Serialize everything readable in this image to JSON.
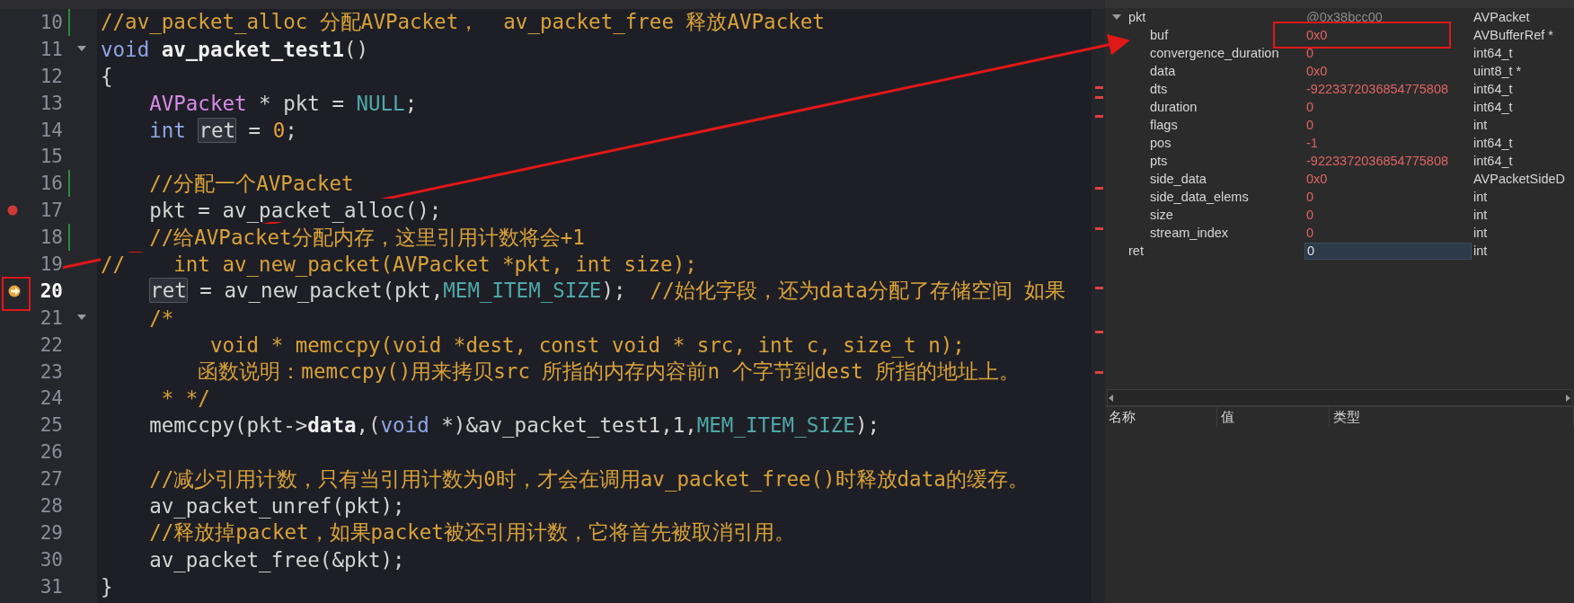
{
  "editor": {
    "lines": [
      {
        "number": "10",
        "fold": false,
        "breakpoint": false,
        "current": false,
        "changed": true,
        "tokens": [
          {
            "kind": "comment",
            "t": "//av_packet_alloc 分配AVPacket，  av_packet_free 释放AVPacket"
          }
        ]
      },
      {
        "number": "11",
        "fold": true,
        "breakpoint": false,
        "current": false,
        "changed": false,
        "tokens": [
          {
            "kind": "keyword",
            "t": "void "
          },
          {
            "kind": "bold",
            "t": "av_packet_test1"
          },
          {
            "kind": "plain",
            "t": "()"
          }
        ]
      },
      {
        "number": "12",
        "fold": false,
        "breakpoint": false,
        "current": false,
        "changed": false,
        "tokens": [
          {
            "kind": "plain",
            "t": "{"
          }
        ]
      },
      {
        "number": "13",
        "fold": false,
        "breakpoint": false,
        "current": false,
        "changed": false,
        "tokens": [
          {
            "kind": "type",
            "t": "    AVPacket"
          },
          {
            "kind": "plain",
            "t": " * pkt = "
          },
          {
            "kind": "macro",
            "t": "NULL"
          },
          {
            "kind": "plain",
            "t": ";"
          }
        ]
      },
      {
        "number": "14",
        "fold": false,
        "breakpoint": false,
        "current": false,
        "changed": false,
        "tokens": [
          {
            "kind": "keyword",
            "t": "    int"
          },
          {
            "kind": "mark",
            "t": " ret"
          },
          {
            "kind": "plain",
            "t": " = "
          },
          {
            "kind": "number",
            "t": "0"
          },
          {
            "kind": "plain",
            "t": ";"
          }
        ]
      },
      {
        "number": "15",
        "fold": false,
        "breakpoint": false,
        "current": false,
        "changed": false
      },
      {
        "number": "16",
        "fold": false,
        "breakpoint": false,
        "current": false,
        "changed": true,
        "tokens": [
          {
            "kind": "comment",
            "t": "    //分配一个AVPacket"
          }
        ]
      },
      {
        "number": "17",
        "fold": false,
        "breakpoint": true,
        "current": false,
        "changed": false,
        "tokens": [
          {
            "kind": "plain",
            "t": "    pkt = av_packet_alloc();"
          }
        ]
      },
      {
        "number": "18",
        "fold": false,
        "breakpoint": false,
        "current": false,
        "changed": true,
        "tokens": [
          {
            "kind": "comment",
            "t": "    //给AVPacket分配内存，这里引用计数将会+1"
          }
        ]
      },
      {
        "number": "19",
        "fold": false,
        "breakpoint": false,
        "current": false,
        "changed": false,
        "tokens": [
          {
            "kind": "comment",
            "t": "//    int av_new_packet(AVPacket *pkt, int size);"
          }
        ]
      },
      {
        "number": "20",
        "fold": false,
        "breakpoint": false,
        "current": true,
        "changed": false,
        "tokens": [
          {
            "kind": "mark",
            "t": "    ret"
          },
          {
            "kind": "plain",
            "t": " = av_new_packet(pkt,"
          },
          {
            "kind": "macro",
            "t": "MEM_ITEM_SIZE"
          },
          {
            "kind": "plain",
            "t": ");  "
          },
          {
            "kind": "comment",
            "t": "//始化字段，还为data分配了存储空间 如果"
          }
        ]
      },
      {
        "number": "21",
        "fold": true,
        "breakpoint": false,
        "current": false,
        "changed": false,
        "tokens": [
          {
            "kind": "comment",
            "t": "    /*"
          }
        ]
      },
      {
        "number": "22",
        "fold": false,
        "breakpoint": false,
        "current": false,
        "changed": false,
        "tokens": [
          {
            "kind": "comment",
            "t": "         void * memccpy(void *dest, const void * src, int c, size_t n);"
          }
        ]
      },
      {
        "number": "23",
        "fold": false,
        "breakpoint": false,
        "current": false,
        "changed": false,
        "tokens": [
          {
            "kind": "comment",
            "t": "        函数说明：memccpy()用来拷贝src 所指的内存内容前n 个字节到dest 所指的地址上。"
          }
        ]
      },
      {
        "number": "24",
        "fold": false,
        "breakpoint": false,
        "current": false,
        "changed": false,
        "tokens": [
          {
            "kind": "comment",
            "t": "     * */"
          }
        ]
      },
      {
        "number": "25",
        "fold": false,
        "breakpoint": false,
        "current": false,
        "changed": false,
        "tokens": [
          {
            "kind": "plain",
            "t": "    memccpy(pkt->"
          },
          {
            "kind": "bold",
            "t": "data"
          },
          {
            "kind": "plain",
            "t": ",("
          },
          {
            "kind": "keyword",
            "t": "void"
          },
          {
            "kind": "plain",
            "t": " *)&av_packet_test1,1,"
          },
          {
            "kind": "macro",
            "t": "MEM_ITEM_SIZE"
          },
          {
            "kind": "plain",
            "t": ");"
          }
        ]
      },
      {
        "number": "26",
        "fold": false,
        "breakpoint": false,
        "current": false,
        "changed": false
      },
      {
        "number": "27",
        "fold": false,
        "breakpoint": false,
        "current": false,
        "changed": false,
        "tokens": [
          {
            "kind": "comment",
            "t": "    //减少引用计数，只有当引用计数为0时，才会在调用av_packet_free()时释放data的缓存。"
          }
        ]
      },
      {
        "number": "28",
        "fold": false,
        "breakpoint": false,
        "current": false,
        "changed": false,
        "tokens": [
          {
            "kind": "plain",
            "t": "    av_packet_unref(pkt);"
          }
        ]
      },
      {
        "number": "29",
        "fold": false,
        "breakpoint": false,
        "current": false,
        "changed": false,
        "tokens": [
          {
            "kind": "comment",
            "t": "    //释放掉packet，如果packet被还引用计数，它将首先被取消引用。"
          }
        ]
      },
      {
        "number": "30",
        "fold": false,
        "breakpoint": false,
        "current": false,
        "changed": false,
        "tokens": [
          {
            "kind": "plain",
            "t": "    av_packet_free(&pkt);"
          }
        ]
      },
      {
        "number": "31",
        "fold": false,
        "breakpoint": false,
        "current": false,
        "changed": false,
        "tokens": [
          {
            "kind": "plain",
            "t": "}"
          }
        ]
      }
    ]
  },
  "watch": {
    "items": [
      {
        "name": "pkt",
        "value": "@0x38bcc00",
        "type": "AVPacket",
        "expanded": true,
        "changed": false,
        "selected": false,
        "children": [
          {
            "name": "buf",
            "value": "0x0",
            "type": "AVBufferRef *",
            "changed": true,
            "selected": false
          },
          {
            "name": "convergence_duration",
            "value": "0",
            "type": "int64_t",
            "changed": true,
            "selected": false
          },
          {
            "name": "data",
            "value": "0x0",
            "type": "uint8_t *",
            "changed": true,
            "selected": false
          },
          {
            "name": "dts",
            "value": "-9223372036854775808",
            "type": "int64_t",
            "changed": true,
            "selected": false
          },
          {
            "name": "duration",
            "value": "0",
            "type": "int64_t",
            "changed": true,
            "selected": false
          },
          {
            "name": "flags",
            "value": "0",
            "type": "int",
            "changed": true,
            "selected": false
          },
          {
            "name": "pos",
            "value": "-1",
            "type": "int64_t",
            "changed": true,
            "selected": false
          },
          {
            "name": "pts",
            "value": "-9223372036854775808",
            "type": "int64_t",
            "changed": true,
            "selected": false
          },
          {
            "name": "side_data",
            "value": "0x0",
            "type": "AVPacketSideD",
            "changed": true,
            "selected": false
          },
          {
            "name": "side_data_elems",
            "value": "0",
            "type": "int",
            "changed": true,
            "selected": false
          },
          {
            "name": "size",
            "value": "0",
            "type": "int",
            "changed": true,
            "selected": false
          },
          {
            "name": "stream_index",
            "value": "0",
            "type": "int",
            "changed": true,
            "selected": false
          }
        ]
      },
      {
        "name": "ret",
        "value": "0",
        "type": "int",
        "changed": false,
        "selected": true
      }
    ]
  },
  "lower_table": {
    "columns": [
      "名称",
      "值",
      "类型"
    ]
  }
}
